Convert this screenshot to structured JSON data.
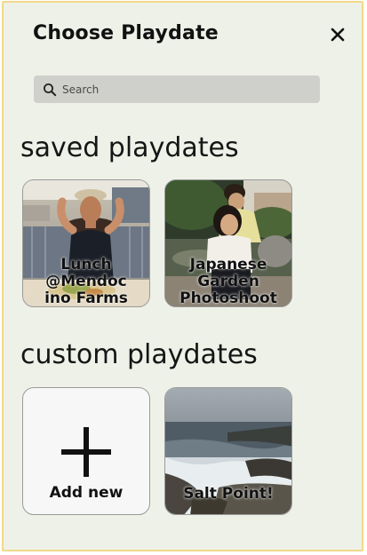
{
  "header": {
    "title": "Choose Playdate",
    "close_icon": "close-icon"
  },
  "search": {
    "placeholder": "Search",
    "value": "",
    "icon": "search-icon"
  },
  "saved": {
    "heading": "saved playdates",
    "cards": [
      {
        "label_lines": [
          "Lunch",
          "@Mendoc",
          "ino Farms"
        ],
        "photo": "woman at restaurant table with food"
      },
      {
        "label_lines": [
          "Japanese",
          "Garden",
          "Photoshoot"
        ],
        "photo": "two people at a garden pond"
      }
    ]
  },
  "custom": {
    "heading": "custom playdates",
    "add_card": {
      "label": "Add new",
      "icon": "plus-icon"
    },
    "cards": [
      {
        "label": "Salt Point!",
        "photo": "rocky coastline with ocean waves"
      }
    ]
  },
  "colors": {
    "panel_bg": "#eef1e7",
    "panel_border": "#f1d98a",
    "search_bg": "#cfd0cc"
  }
}
